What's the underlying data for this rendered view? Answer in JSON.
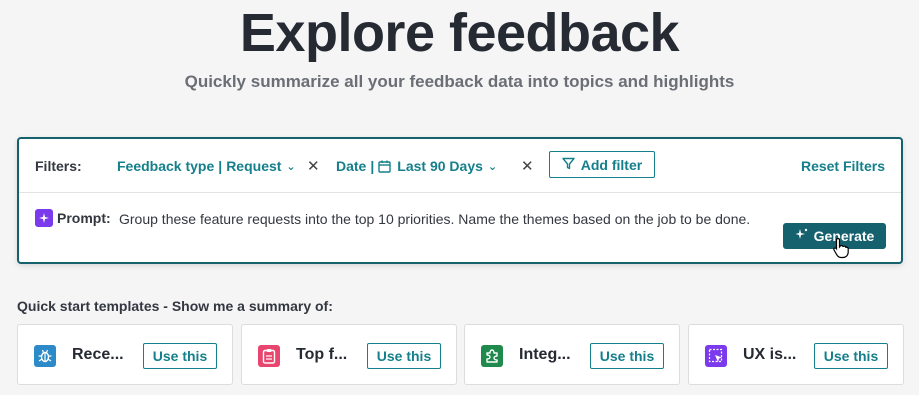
{
  "header": {
    "title": "Explore feedback",
    "subtitle": "Quickly summarize all your feedback data into topics and highlights"
  },
  "filters": {
    "label": "Filters:",
    "feedback_type": {
      "name": "Feedback type",
      "separator": "|",
      "value": "Request"
    },
    "date": {
      "name": "Date",
      "separator": "|",
      "value": "Last 90 Days"
    },
    "add_filter_label": "Add filter",
    "reset_label": "Reset Filters"
  },
  "prompt": {
    "label": "Prompt:",
    "text": "Group these feature requests into the top 10 priorities. Name the themes based on the job to be done.",
    "generate_label": "Generate"
  },
  "quick_start": {
    "title": "Quick start templates - Show me a summary of:",
    "cards": [
      {
        "name": "Rece...",
        "button": "Use this",
        "icon": "bug-icon",
        "color": "#2b8ac7"
      },
      {
        "name": "Top f...",
        "button": "Use this",
        "icon": "clipboard-icon",
        "color": "#e8456f"
      },
      {
        "name": "Integ...",
        "button": "Use this",
        "icon": "puzzle-icon",
        "color": "#1f8a4c"
      },
      {
        "name": "UX is...",
        "button": "Use this",
        "icon": "cursor-select-icon",
        "color": "#7c3aed"
      }
    ]
  },
  "colors": {
    "accent": "#15808c",
    "primary_button": "#15616d",
    "prompt_icon": "#7c3aed"
  }
}
